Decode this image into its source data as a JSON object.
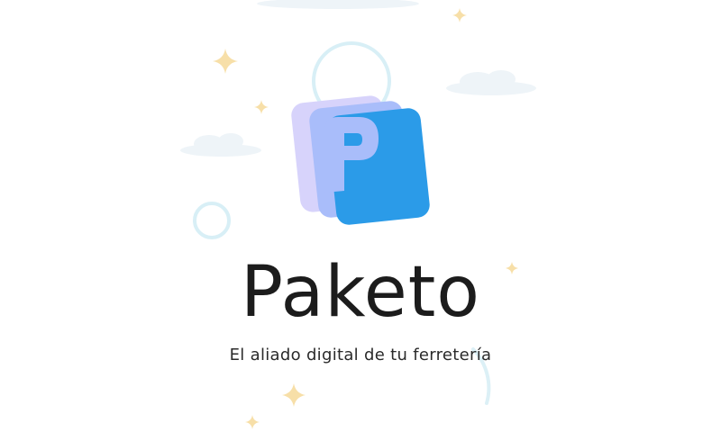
{
  "splash": {
    "brand_name": "Paketo",
    "tagline": "El aliado digital de tu ferretería",
    "logo_icon": "stacked-pages-p-logo-icon"
  },
  "colors": {
    "background": "#ffffff",
    "brand_text": "#1c1c1c",
    "logo_primary": "#2b9be8",
    "logo_secondary": "#a9bdfa",
    "logo_tertiary": "#d7d3fb",
    "sparkle": "#f7dfa8",
    "ring": "#d8eff6",
    "cloud": "#eef4f8"
  }
}
